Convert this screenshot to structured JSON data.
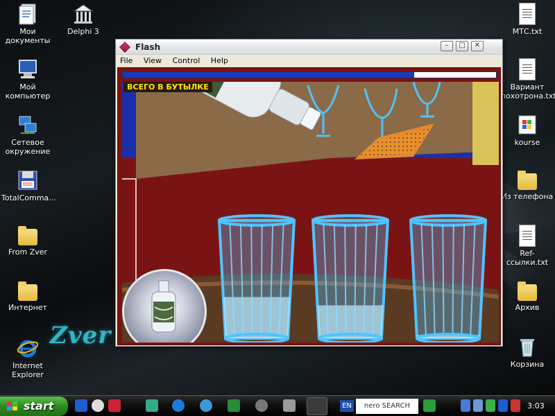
{
  "desktop": {
    "left_icons": [
      {
        "id": "my-documents",
        "label": "Мои документы",
        "icon": "documents-icon"
      },
      {
        "id": "delphi",
        "label": "Delphi 3",
        "icon": "delphi-icon"
      },
      {
        "id": "my-computer",
        "label": "Мой компьютер",
        "icon": "computer-icon"
      },
      {
        "id": "network",
        "label": "Сетевое окружение",
        "icon": "network-icon"
      },
      {
        "id": "totalcommander",
        "label": "TotalComma...",
        "icon": "floppy-icon"
      },
      {
        "id": "from-zver",
        "label": "From Zver",
        "icon": "folder-icon"
      },
      {
        "id": "internet-folder",
        "label": "Интернет",
        "icon": "folder-icon"
      },
      {
        "id": "internet-explorer",
        "label": "Internet Explorer",
        "icon": "ie-icon"
      }
    ],
    "right_icons": [
      {
        "id": "mts-txt",
        "label": "МТС.txt",
        "icon": "text-file-icon"
      },
      {
        "id": "variant-txt",
        "label": "Вариант лохотрона.txt",
        "icon": "text-file-icon"
      },
      {
        "id": "kourse",
        "label": "kourse",
        "icon": "windows-app-icon"
      },
      {
        "id": "iz-telefona",
        "label": "Из телефона",
        "icon": "folder-icon"
      },
      {
        "id": "ref-links",
        "label": "Ref-ссылки.txt",
        "icon": "text-file-icon"
      },
      {
        "id": "arhiv",
        "label": "Архив",
        "icon": "folder-icon"
      },
      {
        "id": "korzina",
        "label": "Корзина",
        "icon": "recycle-bin-icon"
      }
    ],
    "wallpaper_text": "Zver OS"
  },
  "window": {
    "title": "Flash",
    "menu": [
      "File",
      "View",
      "Control",
      "Help"
    ],
    "controls": {
      "minimize": "–",
      "maximize": "□",
      "close": "✕"
    }
  },
  "game": {
    "bottle_title": "ВСЕГО В БУТЫЛКЕ",
    "bottle_remaining_fraction": 0.78,
    "glass_fill_levels": [
      0.25,
      0.2,
      0.02
    ],
    "colors": {
      "stage_border": "#7a1414",
      "progress": "#1a3bb8",
      "wall_blue": "#1b2fa8",
      "glass": "#4fc3ff",
      "label_text": "#ffe600"
    }
  },
  "taskbar": {
    "start_label": "start",
    "language": "EN",
    "nero_label": "nero SEARCH",
    "clock": "3:03"
  }
}
